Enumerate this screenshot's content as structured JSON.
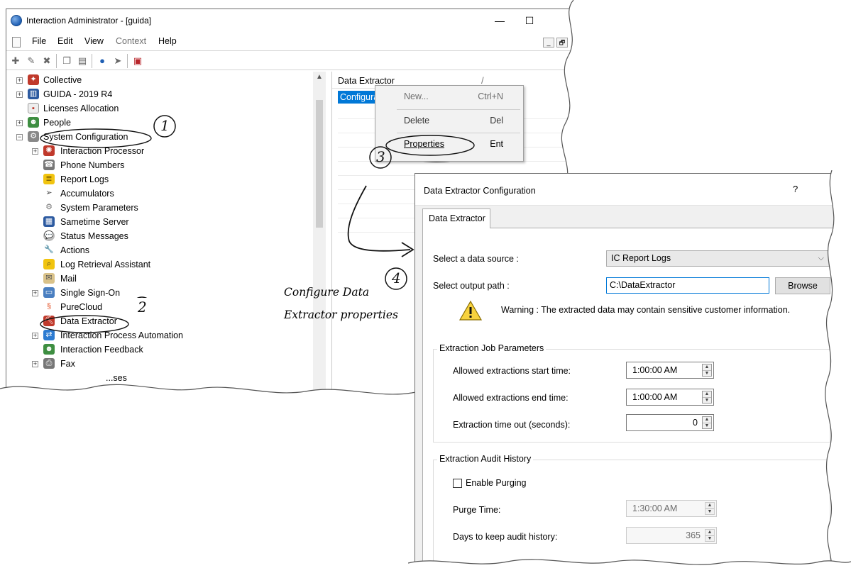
{
  "window": {
    "title": "Interaction Administrator - [guida]",
    "minimize": "—",
    "maximize": "☐"
  },
  "menu": {
    "items": [
      "File",
      "Edit",
      "View",
      "Context",
      "Help"
    ],
    "mdi_min": "_",
    "mdi_restore": "🗗"
  },
  "tree": {
    "items": [
      {
        "label": "Collective"
      },
      {
        "label": "GUIDA - 2019 R4"
      },
      {
        "label": "Licenses Allocation"
      },
      {
        "label": "People"
      },
      {
        "label": "System Configuration"
      },
      {
        "label": "Interaction Processor"
      },
      {
        "label": "Phone Numbers"
      },
      {
        "label": "Report Logs"
      },
      {
        "label": "Accumulators"
      },
      {
        "label": "System Parameters"
      },
      {
        "label": "Sametime Server"
      },
      {
        "label": "Status Messages"
      },
      {
        "label": "Actions"
      },
      {
        "label": "Log Retrieval Assistant"
      },
      {
        "label": "Mail"
      },
      {
        "label": "Single Sign-On"
      },
      {
        "label": "PureCloud"
      },
      {
        "label": "Data Extractor"
      },
      {
        "label": "Interaction Process Automation"
      },
      {
        "label": "Interaction Feedback"
      },
      {
        "label": "Fax"
      },
      {
        "label": "...ses"
      }
    ],
    "expand_plus": "+",
    "expand_minus": "−"
  },
  "right_pane": {
    "header": "Data Extractor",
    "header_sep": "/",
    "selected_row": "Configuration"
  },
  "context_menu": {
    "new": {
      "label": "New...",
      "shortcut": "Ctrl+N"
    },
    "delete": {
      "label": "Delete",
      "shortcut": "Del"
    },
    "properties": {
      "label": "Properties",
      "shortcut": "Ent"
    }
  },
  "annotations": {
    "step1": "1",
    "step2": "2",
    "step3": "3",
    "step4": "4",
    "line1": "Configure Data",
    "line2": "Extractor properties"
  },
  "dialog": {
    "title": "Data Extractor Configuration",
    "help": "?",
    "tab": "Data Extractor",
    "data_source_label": "Select a data source :",
    "data_source_value": "IC Report Logs",
    "output_path_label": "Select output path :",
    "output_path_value": "C:\\DataExtractor",
    "browse": "Browse",
    "warning": "Warning : The extracted data may contain sensitive customer information.",
    "job_group": "Extraction Job Parameters",
    "start_label": "Allowed extractions start time:",
    "start_value": "1:00:00 AM",
    "end_label": "Allowed extractions end time:",
    "end_value": "1:00:00 AM",
    "timeout_label": "Extraction time out (seconds):",
    "timeout_value": "0",
    "audit_group": "Extraction Audit History",
    "purging_label": "Enable Purging",
    "purge_time_label": "Purge Time:",
    "purge_time_value": "1:30:00 AM",
    "days_label": "Days to keep audit history:",
    "days_value": "365"
  }
}
